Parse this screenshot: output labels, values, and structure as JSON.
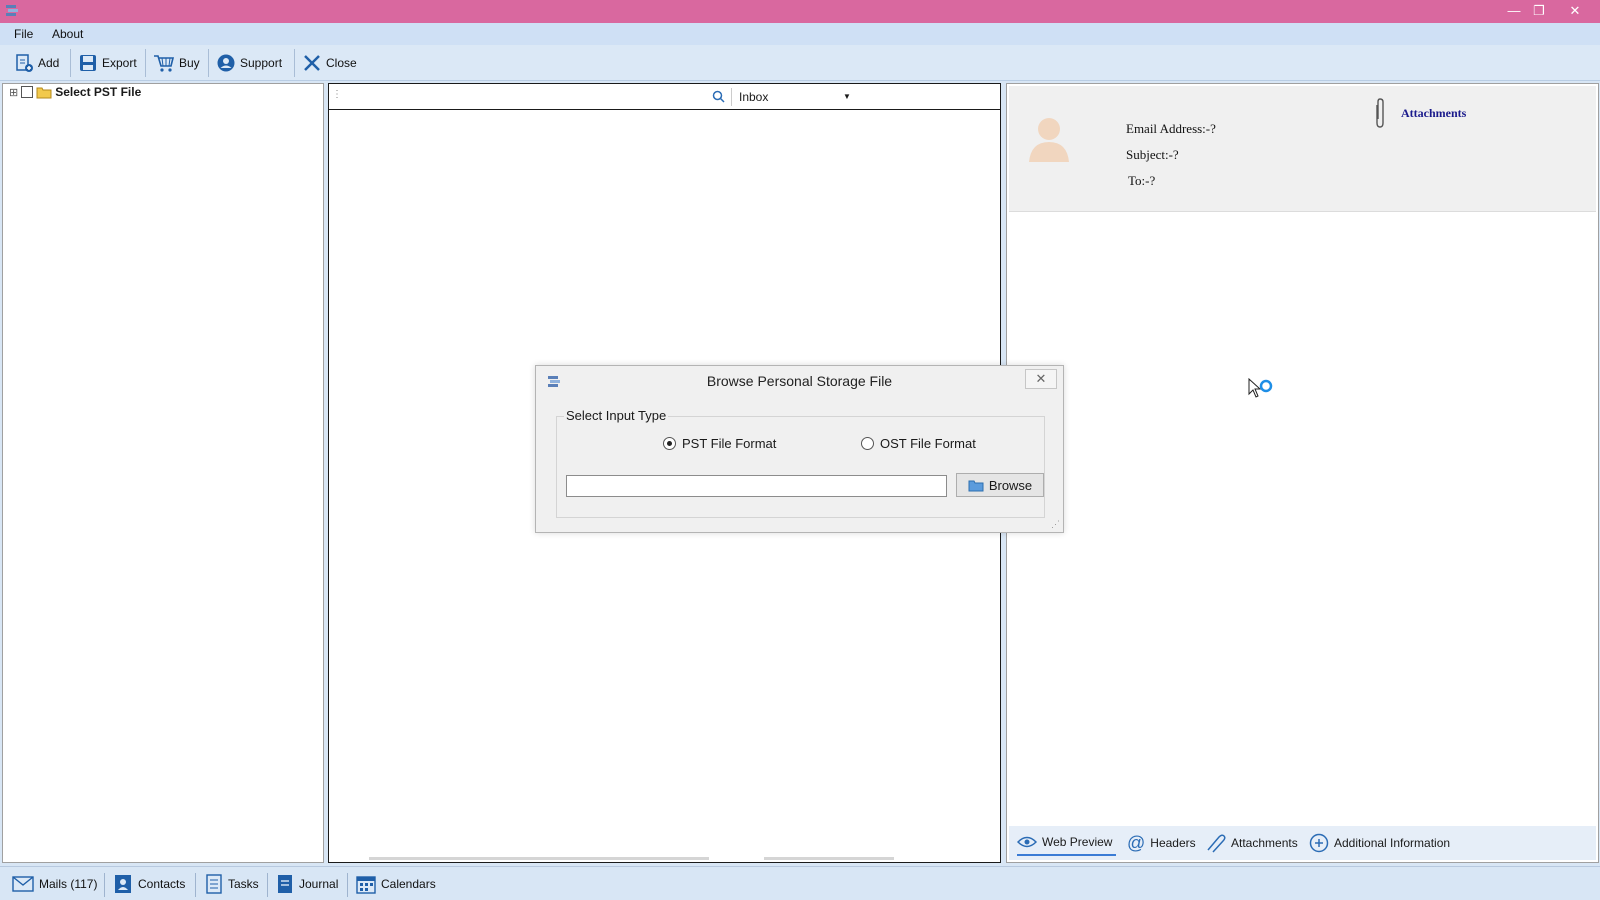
{
  "window": {
    "minimize": "—",
    "restore": "❐",
    "close": "✕"
  },
  "menu": {
    "file": "File",
    "about": "About"
  },
  "toolbar": {
    "add": "Add",
    "export": "Export",
    "buy": "Buy",
    "support": "Support",
    "close": "Close"
  },
  "tree": {
    "root_label": "Select PST File",
    "expander": "⊞"
  },
  "mail_list": {
    "folder": "Inbox"
  },
  "preview": {
    "email_address": "Email Address:-?",
    "subject": "Subject:-?",
    "to": "To:-?",
    "attachments": "Attachments",
    "tabs": [
      "Web Preview",
      "Headers",
      "Attachments",
      "Additional Information"
    ]
  },
  "bottom_tabs": [
    "Mails (117)",
    "Contacts",
    "Tasks",
    "Journal",
    "Calendars"
  ],
  "dialog": {
    "title": "Browse Personal Storage File",
    "close": "✕",
    "group_label": "Select Input Type",
    "options": [
      {
        "label": "PST File Format",
        "selected": true
      },
      {
        "label": "OST File Format",
        "selected": false
      }
    ],
    "path_value": "",
    "browse": "Browse"
  },
  "colors": {
    "titlebar": "#d9689f",
    "accent": "#1f5fa8",
    "link": "#1a1a8c"
  }
}
